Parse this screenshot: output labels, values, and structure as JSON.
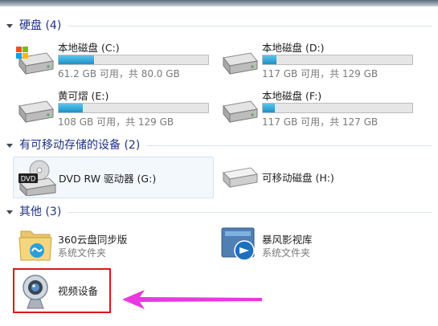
{
  "groups": {
    "hdd": {
      "title": "硬盘 (4)"
    },
    "removable": {
      "title": "有可移动存储的设备 (2)"
    },
    "other": {
      "title": "其他 (3)"
    }
  },
  "drives": [
    {
      "name": "本地磁盘 (C:)",
      "space": "61.2 GB 可用，共 80.0 GB",
      "used_fraction": 0.235
    },
    {
      "name": "本地磁盘 (D:)",
      "space": "117 GB 可用，共 129 GB",
      "used_fraction": 0.093
    },
    {
      "name": "黄可熠 (E:)",
      "space": "108 GB 可用，共 129 GB",
      "used_fraction": 0.163
    },
    {
      "name": "本地磁盘 (F:)",
      "space": "117 GB 可用，共 127 GB",
      "used_fraction": 0.079
    }
  ],
  "removable": [
    {
      "name": "DVD RW 驱动器 (G:)",
      "icon": "dvd-drive-icon",
      "badge": "DVD"
    },
    {
      "name": "可移动磁盘 (H:)",
      "icon": "removable-disk-icon"
    }
  ],
  "other": [
    {
      "name": "360云盘同步版",
      "sub": "系统文件夹",
      "icon": "cloud-folder-icon"
    },
    {
      "name": "暴风影视库",
      "sub": "系统文件夹",
      "icon": "media-library-icon"
    },
    {
      "name": "视频设备",
      "icon": "webcam-icon"
    }
  ],
  "colors": {
    "accent": "#1e3287",
    "highlight": "#e0141e",
    "arrow": "#e838e0"
  }
}
